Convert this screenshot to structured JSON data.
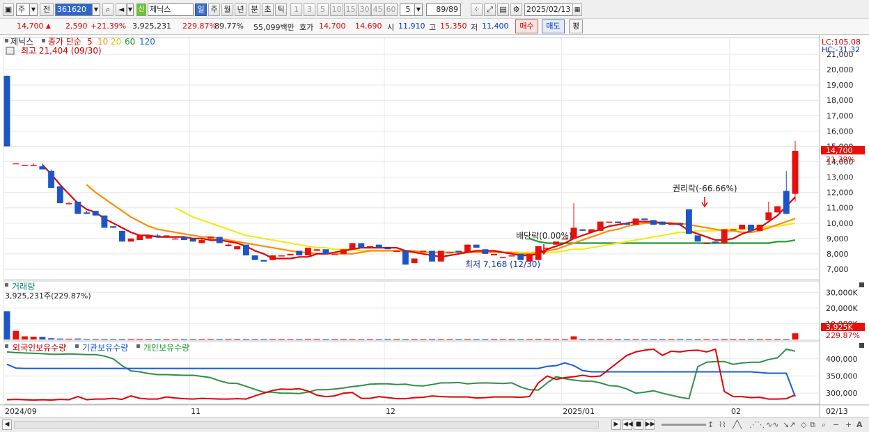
{
  "toolbar": {
    "market_label": "주",
    "prev_label": "전",
    "code": "361620",
    "tag": "신",
    "name": "제닉스",
    "period_day": "일",
    "period_week": "주",
    "period_month": "월",
    "period_year": "년",
    "period_min": "분",
    "period_sec": "초",
    "period_tick": "틱",
    "intervals": [
      "1",
      "3",
      "5",
      "10",
      "15",
      "30",
      "45",
      "60"
    ],
    "interval_value": "5",
    "count": "89/89",
    "date": "2025/02/13"
  },
  "quote": {
    "price": "14,700",
    "change": "2,590",
    "change_pct": "+21.39%",
    "volume": "3,925,231",
    "vol_ratio": "229.87%",
    "turnover": "89.77%",
    "amount": "55,099백만",
    "ask_label": "호가",
    "ask": "14,700",
    "bid": "14,690",
    "open_label": "시",
    "open": "11,910",
    "high_label": "고",
    "high": "15,350",
    "low_label": "저",
    "low": "11,400",
    "buy_label": "매수",
    "sell_label": "매도",
    "eval_label": "평"
  },
  "main_legend": {
    "stock": "제닉스",
    "ma_label": "종가 단순",
    "ma5": "5",
    "ma10": "10",
    "ma20": "20",
    "ma60": "60",
    "ma120": "120",
    "max_label": "최고 21,404 (09/30)",
    "min_label": "최저 7,168 (12/30)",
    "dividend_label": "배당락(0.00%)",
    "rights_label": "권리락(-66.66%)"
  },
  "right_top": {
    "lc": "LC:105.08",
    "hc": "HC:-31.32",
    "price_tag": "14,700",
    "pct_tag": "21.39%",
    "yticks": [
      "21,000",
      "20,000",
      "19,000",
      "18,000",
      "17,000",
      "16,000",
      "15,000",
      "14,000",
      "13,000",
      "12,000",
      "11,000",
      "10,000",
      "9,000",
      "8,000",
      "7,000"
    ]
  },
  "volume_panel": {
    "title": "거래량",
    "info": "3,925,231주(229.87%)",
    "yticks": [
      "30,000K",
      "20,000K",
      "10,000K"
    ],
    "tag": "3,925K",
    "tag_pct": "229.87%"
  },
  "holdings_panel": {
    "foreign": "외국인보유수량",
    "inst": "기관보유수량",
    "indiv": "개인보유수량",
    "yticks": [
      "400,000",
      "350,000",
      "300,000"
    ]
  },
  "xaxis": {
    "labels": [
      "2024/09",
      "11",
      "12",
      "2025/01",
      "02",
      "02/13"
    ]
  },
  "colors": {
    "up": "#e8100c",
    "down": "#1b55c8",
    "ma5": "#e00000",
    "ma10": "#ff8c00",
    "ma20": "#f0ea1c",
    "ma60": "#1e9a2c",
    "ma120": "#1a5cd6"
  },
  "chart_data": {
    "type": "candlestick",
    "price_ylim": [
      7000,
      21000
    ],
    "candles": [
      [
        19600,
        15000,
        19600,
        15000
      ],
      [
        13900,
        13900,
        13900,
        13900
      ],
      [
        13800,
        13800,
        13800,
        13800
      ],
      [
        13800,
        13800,
        13900,
        13800
      ],
      [
        13700,
        13500,
        13900,
        13500
      ],
      [
        13400,
        12300,
        13500,
        12300
      ],
      [
        12400,
        11300,
        12400,
        11300
      ],
      [
        11300,
        11300,
        11400,
        11300
      ],
      [
        11400,
        10600,
        11400,
        10600
      ],
      [
        10700,
        10600,
        10800,
        10600
      ],
      [
        10800,
        10500,
        10800,
        10500
      ],
      [
        10500,
        9700,
        10500,
        9700
      ],
      [
        9800,
        9700,
        9800,
        9700
      ],
      [
        9500,
        8800,
        9500,
        8800
      ],
      [
        8800,
        9000,
        9000,
        8800
      ],
      [
        8900,
        9200,
        9200,
        8900
      ],
      [
        9000,
        9200,
        9200,
        9000
      ],
      [
        9200,
        9100,
        9300,
        9100
      ],
      [
        9100,
        9200,
        9200,
        9100
      ],
      [
        9000,
        9000,
        9100,
        9000
      ],
      [
        9100,
        8900,
        9100,
        8900
      ],
      [
        9000,
        8800,
        9000,
        8800
      ],
      [
        8700,
        8900,
        9000,
        8700
      ],
      [
        9000,
        9100,
        9100,
        9000
      ],
      [
        9100,
        8700,
        9100,
        8700
      ],
      [
        8500,
        8600,
        8700,
        8500
      ],
      [
        8300,
        8500,
        8500,
        8300
      ],
      [
        8600,
        7900,
        8600,
        7900
      ],
      [
        7900,
        7600,
        7900,
        7600
      ],
      [
        7600,
        7500,
        7600,
        7500
      ],
      [
        7600,
        7900,
        7900,
        7600
      ],
      [
        7900,
        7900,
        7900,
        7900
      ],
      [
        7900,
        8000,
        8000,
        7900
      ],
      [
        8200,
        7900,
        8200,
        7900
      ],
      [
        7900,
        8400,
        8400,
        7900
      ],
      [
        8200,
        8300,
        8300,
        8200
      ],
      [
        8300,
        8000,
        8300,
        8000
      ],
      [
        8000,
        8000,
        8000,
        8000
      ],
      [
        8000,
        8300,
        8300,
        8000
      ],
      [
        8300,
        8700,
        8700,
        8300
      ],
      [
        8700,
        8400,
        8700,
        8400
      ],
      [
        8400,
        8500,
        8500,
        8400
      ],
      [
        8600,
        8400,
        8600,
        8400
      ],
      [
        8400,
        8300,
        8400,
        8300
      ],
      [
        8200,
        8200,
        8200,
        8200
      ],
      [
        8200,
        7300,
        8200,
        7300
      ],
      [
        7400,
        7700,
        7700,
        7400
      ],
      [
        8200,
        8200,
        8200,
        8200
      ],
      [
        8200,
        7500,
        8200,
        7500
      ],
      [
        7500,
        8200,
        8200,
        7500
      ],
      [
        8100,
        8100,
        8100,
        8100
      ],
      [
        8200,
        8100,
        8200,
        8100
      ],
      [
        8100,
        8600,
        8600,
        8100
      ],
      [
        8600,
        8400,
        8600,
        8400
      ],
      [
        8300,
        8000,
        8300,
        8000
      ],
      [
        7900,
        8000,
        8000,
        7900
      ],
      [
        7800,
        7800,
        7800,
        7800
      ],
      [
        7900,
        7900,
        7900,
        7900
      ],
      [
        8000,
        7600,
        8000,
        7600
      ],
      [
        7500,
        8000,
        8000,
        7500
      ],
      [
        7600,
        8500,
        8500,
        7600
      ],
      [
        8400,
        8400,
        8400,
        8400
      ],
      [
        8600,
        8800,
        8800,
        8600
      ],
      [
        9000,
        9000,
        9000,
        9000
      ],
      [
        9000,
        9700,
        11300,
        9000
      ],
      [
        9600,
        9500,
        9600,
        9500
      ],
      [
        9400,
        9600,
        9600,
        9400
      ],
      [
        9500,
        10100,
        10100,
        9500
      ],
      [
        10100,
        10100,
        10100,
        10100
      ],
      [
        10100,
        10000,
        10100,
        10000
      ],
      [
        10000,
        9900,
        10000,
        9900
      ],
      [
        9900,
        10300,
        10300,
        9900
      ],
      [
        10300,
        10200,
        10300,
        10200
      ],
      [
        10200,
        9900,
        10200,
        9900
      ],
      [
        10100,
        9900,
        10100,
        9900
      ],
      [
        9900,
        10000,
        10000,
        9900
      ],
      [
        10000,
        9900,
        10000,
        9900
      ],
      [
        10900,
        9300,
        10900,
        9300
      ],
      [
        9200,
        8800,
        9200,
        8800
      ],
      [
        8700,
        8700,
        8700,
        8700
      ],
      [
        8800,
        8700,
        8800,
        8700
      ],
      [
        8700,
        9600,
        9600,
        8700
      ],
      [
        9600,
        9600,
        9600,
        9600
      ],
      [
        9600,
        9900,
        9900,
        9600
      ],
      [
        9900,
        9500,
        9900,
        9500
      ],
      [
        9500,
        9900,
        9900,
        9500
      ],
      [
        10200,
        10700,
        11400,
        10200
      ],
      [
        10700,
        11100,
        11100,
        10700
      ],
      [
        12100,
        10600,
        13400,
        10600
      ],
      [
        11910,
        14700,
        15350,
        11400
      ]
    ],
    "volume_ylim": [
      0,
      35000
    ],
    "volume_k": [
      18000,
      5500,
      2000,
      1800,
      1700,
      800,
      600,
      500,
      600,
      400,
      400,
      300,
      400,
      300,
      300,
      300,
      300,
      300,
      300,
      300,
      300,
      300,
      300,
      300,
      300,
      300,
      300,
      300,
      300,
      300,
      300,
      300,
      300,
      300,
      300,
      300,
      300,
      300,
      300,
      300,
      300,
      300,
      300,
      300,
      300,
      300,
      300,
      300,
      300,
      300,
      300,
      300,
      300,
      300,
      300,
      300,
      300,
      300,
      300,
      300,
      300,
      300,
      300,
      300,
      2000,
      300,
      300,
      300,
      300,
      300,
      300,
      300,
      300,
      300,
      300,
      300,
      300,
      300,
      300,
      300,
      300,
      300,
      300,
      300,
      300,
      300,
      300,
      300,
      300,
      3925
    ],
    "holdings_ylim": [
      270000,
      440000
    ],
    "foreign": [
      281000,
      282000,
      281000,
      280000,
      281000,
      280000,
      282000,
      281000,
      290000,
      281000,
      283000,
      283000,
      285000,
      282000,
      292000,
      285000,
      283000,
      283000,
      289000,
      286000,
      284000,
      283000,
      285000,
      284000,
      283000,
      283000,
      284000,
      283000,
      292000,
      300000,
      308000,
      312000,
      311000,
      313000,
      306000,
      294000,
      290000,
      292000,
      300000,
      302000,
      285000,
      285000,
      290000,
      287000,
      284000,
      284000,
      287000,
      288000,
      292000,
      290000,
      289000,
      289000,
      289000,
      286000,
      287000,
      289000,
      289000,
      289000,
      288000,
      290000,
      330000,
      350000,
      340000,
      345000,
      348000,
      352000,
      348000,
      350000,
      370000,
      390000,
      410000,
      420000,
      425000,
      428000,
      410000,
      422000,
      420000,
      424000,
      425000,
      420000,
      428000,
      305000,
      290000,
      290000,
      287000,
      288000,
      283000,
      283000,
      284000,
      295000
    ],
    "inst": [
      384000,
      373000,
      372000,
      372000,
      372000,
      372000,
      372000,
      372000,
      372000,
      372000,
      372000,
      372000,
      372000,
      372000,
      372000,
      372000,
      372000,
      372000,
      372000,
      372000,
      372000,
      372000,
      372000,
      372000,
      372000,
      372000,
      372000,
      372000,
      372000,
      372000,
      372000,
      372000,
      372000,
      372000,
      372000,
      372000,
      372000,
      372000,
      372000,
      372000,
      372000,
      372000,
      372000,
      372000,
      372000,
      372000,
      372000,
      372000,
      372000,
      372000,
      372000,
      372000,
      372000,
      372000,
      372000,
      372000,
      372000,
      372000,
      372000,
      372000,
      372000,
      378000,
      380000,
      388000,
      380000,
      366000,
      362000,
      362000,
      362000,
      362000,
      362000,
      362000,
      362000,
      362000,
      362000,
      362000,
      362000,
      362000,
      362000,
      362000,
      362000,
      362000,
      362000,
      362000,
      362000,
      360000,
      358000,
      358000,
      358000,
      290000
    ],
    "indiv": [
      420000,
      418000,
      417000,
      416000,
      415000,
      413000,
      413000,
      414000,
      413000,
      412000,
      412000,
      408000,
      400000,
      380000,
      365000,
      362000,
      357000,
      354000,
      354000,
      353000,
      352000,
      352000,
      349000,
      345000,
      336000,
      329000,
      328000,
      320000,
      311000,
      303000,
      303000,
      300000,
      300000,
      299000,
      303000,
      310000,
      310000,
      312000,
      315000,
      319000,
      322000,
      326000,
      327000,
      327000,
      325000,
      326000,
      322000,
      321000,
      325000,
      330000,
      330000,
      331000,
      327000,
      329000,
      330000,
      329000,
      328000,
      330000,
      318000,
      310000,
      309000,
      330000,
      348000,
      342000,
      338000,
      335000,
      335000,
      330000,
      322000,
      320000,
      312000,
      300000,
      303000,
      307000,
      300000,
      294000,
      288000,
      284000,
      377000,
      390000,
      392000,
      392000,
      384000,
      388000,
      390000,
      390000,
      398000,
      403000,
      428000,
      422000
    ],
    "ma5": [
      null,
      null,
      null,
      null,
      13800,
      13200,
      12500,
      11900,
      11300,
      10900,
      10700,
      10300,
      10000,
      9700,
      9400,
      9200,
      9200,
      9100,
      9100,
      9100,
      9100,
      9000,
      9000,
      8900,
      8900,
      8800,
      8700,
      8500,
      8200,
      8000,
      7700,
      7700,
      7700,
      7800,
      7800,
      8000,
      8000,
      8100,
      8200,
      8300,
      8400,
      8400,
      8400,
      8400,
      8400,
      8200,
      8100,
      8000,
      7900,
      7800,
      7900,
      8000,
      8100,
      8200,
      8200,
      8200,
      8100,
      8000,
      7900,
      7900,
      8000,
      8300,
      8500,
      8700,
      9000,
      9200,
      9400,
      9600,
      9800,
      9900,
      10000,
      10100,
      10100,
      10100,
      10000,
      10000,
      9900,
      9500,
      9300,
      9100,
      8900,
      8900,
      9000,
      9300,
      9500,
      9700,
      10100,
      10500,
      11100,
      11700
    ],
    "ma10": [
      null,
      null,
      null,
      null,
      null,
      null,
      null,
      null,
      null,
      12500,
      12000,
      11600,
      11200,
      10800,
      10400,
      10100,
      9800,
      9600,
      9500,
      9400,
      9300,
      9200,
      9100,
      9100,
      9000,
      8900,
      8800,
      8700,
      8600,
      8500,
      8400,
      8300,
      8200,
      8100,
      8100,
      8000,
      8000,
      8000,
      8000,
      8000,
      8100,
      8200,
      8200,
      8200,
      8200,
      8200,
      8200,
      8100,
      8100,
      8100,
      8100,
      8100,
      8100,
      8100,
      8100,
      8100,
      8100,
      8100,
      8000,
      8000,
      8100,
      8200,
      8300,
      8500,
      8700,
      8900,
      9100,
      9300,
      9500,
      9600,
      9800,
      9900,
      10000,
      10000,
      10000,
      10000,
      10000,
      9900,
      9800,
      9700,
      9600,
      9500,
      9500,
      9400,
      9400,
      9500,
      9700,
      9900,
      10100,
      10300
    ],
    "ma20": [
      null,
      null,
      null,
      null,
      null,
      null,
      null,
      null,
      null,
      null,
      null,
      null,
      null,
      null,
      null,
      null,
      null,
      null,
      null,
      11000,
      10700,
      10400,
      10200,
      10000,
      9800,
      9600,
      9400,
      9200,
      9100,
      9000,
      8900,
      8800,
      8700,
      8600,
      8500,
      8400,
      8400,
      8300,
      8300,
      8300,
      8200,
      8200,
      8200,
      8200,
      8200,
      8100,
      8100,
      8100,
      8100,
      8100,
      8100,
      8100,
      8100,
      8100,
      8100,
      8100,
      8100,
      8100,
      8100,
      8100,
      8100,
      8100,
      8100,
      8200,
      8300,
      8300,
      8400,
      8500,
      8600,
      8700,
      8800,
      8900,
      9000,
      9100,
      9200,
      9300,
      9400,
      9400,
      9500,
      9500,
      9500,
      9600,
      9600,
      9600,
      9700,
      9700,
      9800,
      9800,
      9900,
      10000
    ],
    "ma60": [
      null,
      null,
      null,
      null,
      null,
      null,
      null,
      null,
      null,
      null,
      null,
      null,
      null,
      null,
      null,
      null,
      null,
      null,
      null,
      null,
      null,
      null,
      null,
      null,
      null,
      null,
      null,
      null,
      null,
      null,
      null,
      null,
      null,
      null,
      null,
      null,
      null,
      null,
      null,
      null,
      null,
      null,
      null,
      null,
      null,
      null,
      null,
      null,
      null,
      null,
      null,
      null,
      null,
      null,
      null,
      null,
      null,
      null,
      null,
      9000,
      8800,
      8700,
      8700,
      8700,
      8700,
      8700,
      8700,
      8700,
      8700,
      8700,
      8700,
      8700,
      8700,
      8700,
      8700,
      8700,
      8700,
      8700,
      8700,
      8700,
      8700,
      8700,
      8700,
      8700,
      8700,
      8700,
      8700,
      8800,
      8800,
      8900
    ]
  }
}
